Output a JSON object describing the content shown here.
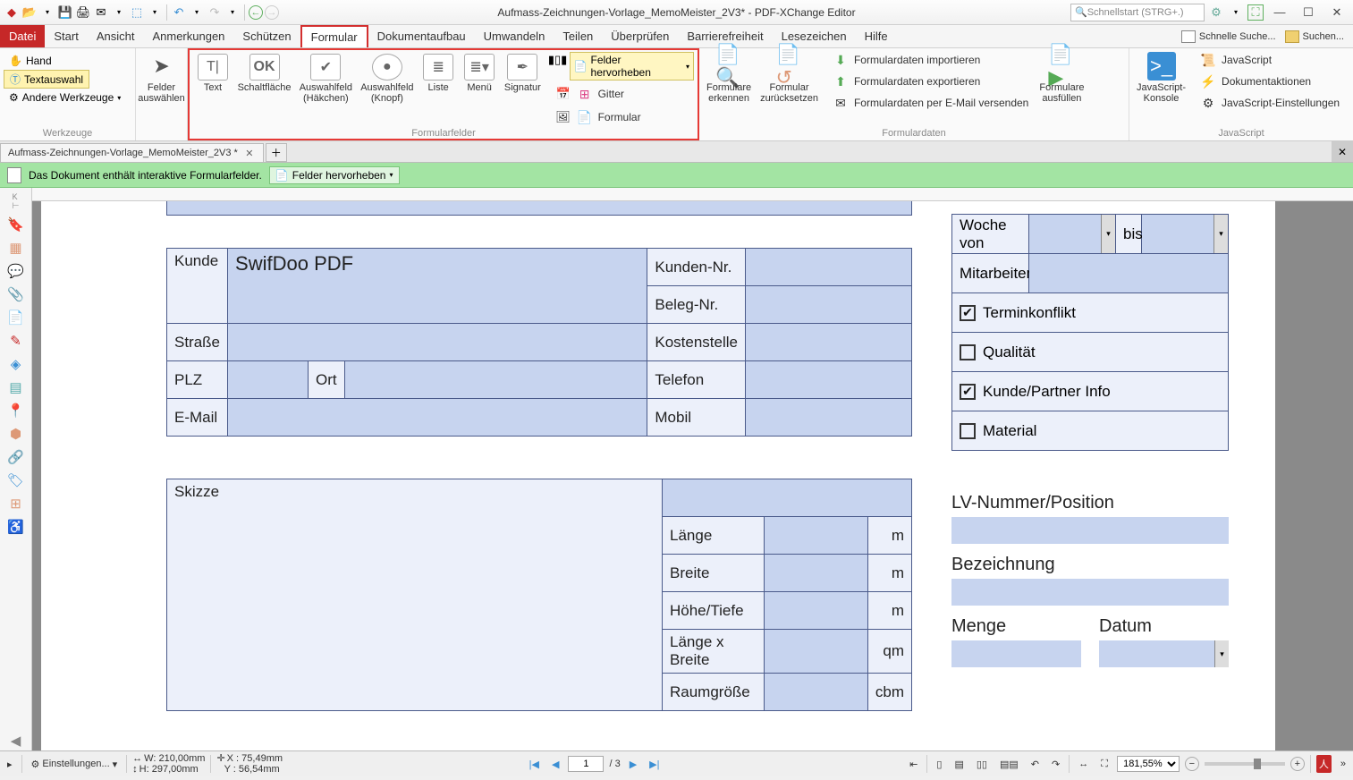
{
  "titlebar": {
    "title": "Aufmass-Zeichnungen-Vorlage_MemoMeister_2V3* - PDF-XChange Editor",
    "quicksearch_placeholder": "Schnellstart (STRG+.)"
  },
  "menubar": {
    "file": "Datei",
    "items": [
      "Start",
      "Ansicht",
      "Anmerkungen",
      "Schützen",
      "Formular",
      "Dokumentaufbau",
      "Umwandeln",
      "Teilen",
      "Überprüfen",
      "Barrierefreiheit",
      "Lesezeichen",
      "Hilfe"
    ],
    "active_index": 4,
    "right": {
      "schnelle": "Schnelle Suche...",
      "suchen": "Suchen..."
    }
  },
  "ribbon": {
    "werkzeuge": {
      "hand": "Hand",
      "textauswahl": "Textauswahl",
      "andere": "Andere Werkzeuge",
      "felder_auswaehlen": "Felder\nauswählen",
      "label": "Werkzeuge"
    },
    "formularfelder": {
      "items": [
        "Text",
        "Schaltfläche",
        "Auswahlfeld\n(Häkchen)",
        "Auswahlfeld\n(Knopf)",
        "Liste",
        "Menü",
        "Signatur"
      ],
      "felder_hervorheben": "Felder hervorheben",
      "gitter": "Gitter",
      "formular": "Formular",
      "label": "Formularfelder"
    },
    "formulare": {
      "erkennen": "Formulare\nerkennen",
      "zuruecksetzen": "Formular\nzurücksetzen",
      "importieren": "Formulardaten importieren",
      "exportieren": "Formulardaten exportieren",
      "email": "Formulardaten per E-Mail versenden",
      "ausfuellen": "Formulare\nausfüllen",
      "label": "Formulardaten"
    },
    "javascript": {
      "konsole": "JavaScript-\nKonsole",
      "js": "JavaScript",
      "aktionen": "Dokumentaktionen",
      "einst": "JavaScript-Einstellungen",
      "label": "JavaScript"
    }
  },
  "tabs": {
    "doc": "Aufmass-Zeichnungen-Vorlage_MemoMeister_2V3 *"
  },
  "infobar": {
    "msg": "Das Dokument enthält interaktive Formularfelder.",
    "btn": "Felder hervorheben"
  },
  "form": {
    "kunde": "Kunde",
    "kunde_val": "SwifDoo PDF",
    "kundennr": "Kunden-Nr.",
    "belegnr": "Beleg-Nr.",
    "strasse": "Straße",
    "kostenstelle": "Kostenstelle",
    "plz": "PLZ",
    "ort": "Ort",
    "telefon": "Telefon",
    "email": "E-Mail",
    "mobil": "Mobil",
    "woche_von": "Woche von",
    "bis": "bis",
    "mitarbeiter": "Mitarbeiter",
    "chk_terminkonflikt": "Terminkonflikt",
    "chk_qualitaet": "Qualität",
    "chk_kundepartner": "Kunde/Partner Info",
    "chk_material": "Material",
    "skizze": "Skizze",
    "laenge": "Länge",
    "m": "m",
    "breite": "Breite",
    "hoehe": "Höhe/Tiefe",
    "lxb": "Länge x Breite",
    "qm": "qm",
    "raumgroesse": "Raumgröße",
    "cbm": "cbm",
    "lv": "LV-Nummer/Position",
    "bezeichnung": "Bezeichnung",
    "menge": "Menge",
    "datum": "Datum"
  },
  "statusbar": {
    "einst": "Einstellungen...",
    "w": "W: 210,00mm",
    "h": "H: 297,00mm",
    "x": "X : 75,49mm",
    "y": "Y : 56,54mm",
    "page_current": "1",
    "page_total": "/ 3",
    "zoom": "181,55%"
  }
}
